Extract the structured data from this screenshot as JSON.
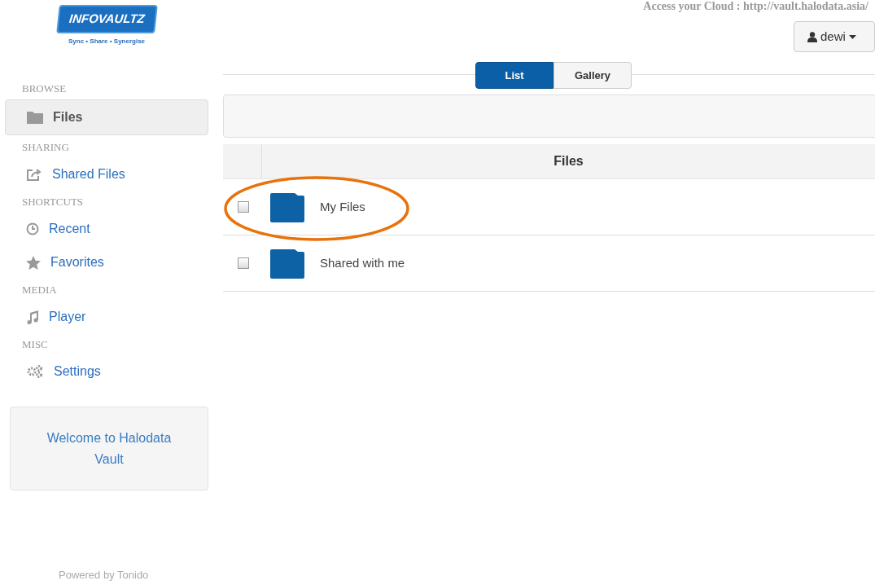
{
  "logo": {
    "name": "INFOVAULTZ",
    "tagline": "Sync • Share • Synergise"
  },
  "sidebar": {
    "sections": [
      {
        "heading": "BROWSE",
        "items": [
          {
            "label": "Files",
            "kind": "folder",
            "selected": true
          }
        ]
      },
      {
        "heading": "SHARING",
        "items": [
          {
            "label": "Shared Files",
            "kind": "share",
            "selected": false
          }
        ]
      },
      {
        "heading": "SHORTCUTS",
        "items": [
          {
            "label": "Recent",
            "kind": "clock",
            "selected": false
          },
          {
            "label": "Favorites",
            "kind": "star",
            "selected": false
          }
        ]
      },
      {
        "heading": "MEDIA",
        "items": [
          {
            "label": "Player",
            "kind": "music",
            "selected": false
          }
        ]
      },
      {
        "heading": "MISC",
        "items": [
          {
            "label": "Settings",
            "kind": "gears",
            "selected": false
          }
        ]
      }
    ],
    "welcome": "Welcome to Halodata Vault",
    "footer": "Powered by Tonido"
  },
  "header": {
    "access_text": "Access your Cloud : http://vault.halodata.asia/",
    "user": "dewi"
  },
  "view_toggle": [
    {
      "label": "List",
      "selected": true
    },
    {
      "label": "Gallery",
      "selected": false
    }
  ],
  "table": {
    "columns": [
      "Files"
    ],
    "rows": [
      {
        "name": "My Files",
        "checked": false,
        "circled": true
      },
      {
        "name": "Shared with me",
        "checked": false,
        "circled": false
      }
    ]
  }
}
